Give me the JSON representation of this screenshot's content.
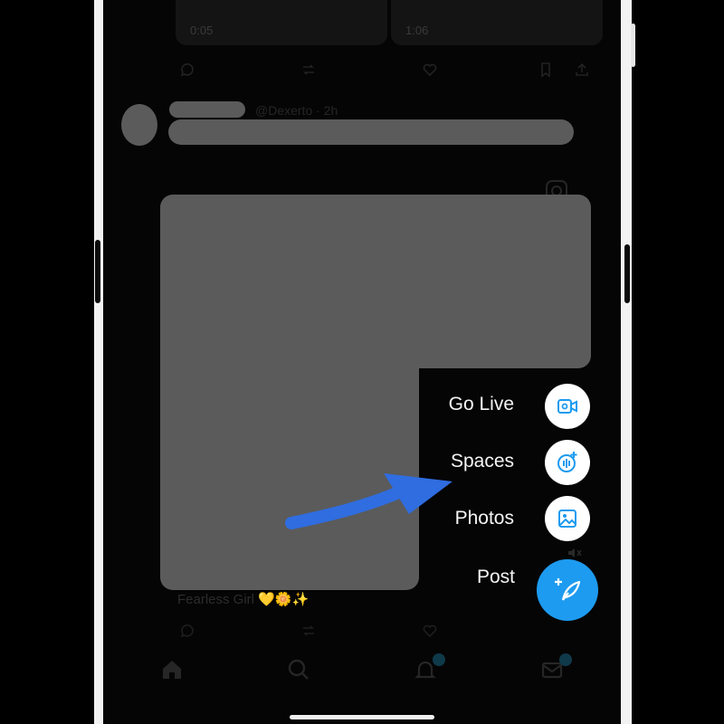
{
  "feed": {
    "video_time_left": "0:05",
    "video_time_right": "1:06",
    "post_meta": "@Dexerto · 2h",
    "caption": "Fearless Girl 💛🌼✨"
  },
  "speed_dial": {
    "items": [
      {
        "label": "Go Live",
        "icon": "video-plus-icon"
      },
      {
        "label": "Spaces",
        "icon": "spaces-mic-icon"
      },
      {
        "label": "Photos",
        "icon": "image-icon"
      },
      {
        "label": "Post",
        "icon": "feather-plus-icon"
      }
    ]
  },
  "colors": {
    "accent": "#1d9bf0",
    "arrow": "#2f6de0",
    "redaction": "#5b5b5b"
  }
}
